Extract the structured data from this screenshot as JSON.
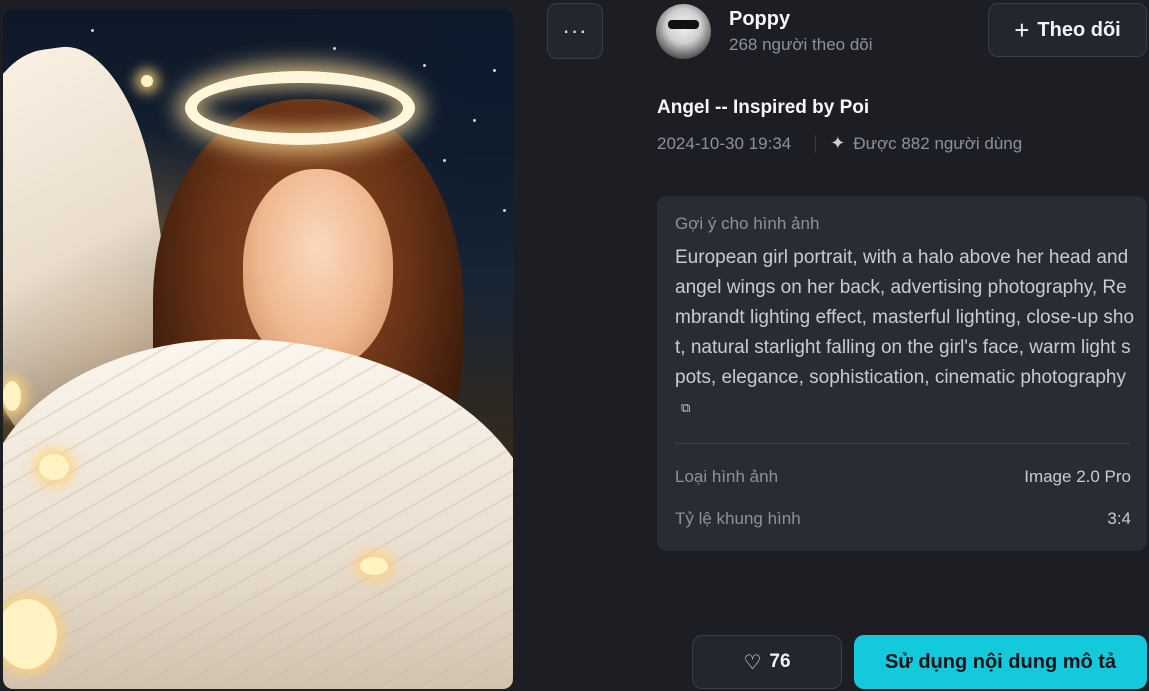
{
  "author": {
    "name": "Poppy",
    "followers": "268 người theo dõi",
    "follow_label": "Theo dõi"
  },
  "more_label": "···",
  "work": {
    "title": "Angel -- Inspired by Poi",
    "timestamp": "2024-10-30 19:34",
    "used_by": "Được 882 người dùng"
  },
  "prompt_card": {
    "label": "Gợi ý cho hình ảnh",
    "text": "European girl portrait, with a halo above her head and angel wings on her back, advertising photography, Rembrandt lighting effect, masterful lighting, close-up shot, natural starlight falling on the girl's face, warm light spots, elegance, sophistication, cinematic photography",
    "properties": [
      {
        "key": "Loại hình ảnh",
        "value": "Image 2.0 Pro"
      },
      {
        "key": "Tỷ lệ khung hình",
        "value": "3:4"
      }
    ]
  },
  "actions": {
    "like_count": "76",
    "use_label": "Sử dụng nội dung mô tả"
  },
  "icons": {
    "more": "ellipsis-icon",
    "plus": "plus-icon",
    "sparkle": "sparkle-icon",
    "copy": "copy-icon",
    "heart": "heart-icon"
  },
  "colors": {
    "background": "#1c1e24",
    "card": "#292c33",
    "accent": "#14c9dc"
  }
}
